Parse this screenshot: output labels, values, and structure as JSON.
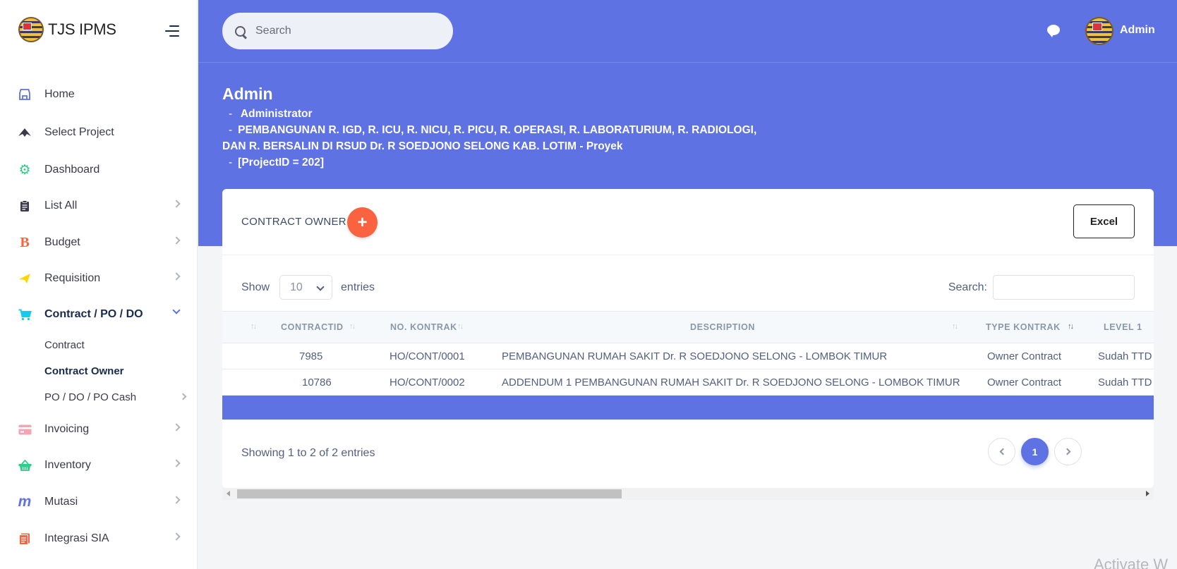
{
  "app": {
    "brand": "TJS IPMS"
  },
  "header": {
    "search_placeholder": "Search",
    "user_name": "Admin"
  },
  "sidebar": {
    "items": [
      {
        "label": "Home",
        "icon": "store-icon",
        "color": "#5e72e4"
      },
      {
        "label": "Select Project",
        "icon": "paper-plane-icon",
        "color": "#3a3a4a"
      },
      {
        "label": "Dashboard",
        "icon": "gear-icon",
        "color": "#2dce89"
      },
      {
        "label": "List All",
        "icon": "clipboard-icon",
        "color": "#3a3a4a"
      },
      {
        "label": "Budget",
        "icon": "bold-b-icon",
        "color": "#fb6340"
      },
      {
        "label": "Requisition",
        "icon": "send-icon",
        "color": "#ffd600"
      },
      {
        "label": "Contract / PO / DO",
        "icon": "cart-icon",
        "color": "#11cdef"
      },
      {
        "label": "Invoicing",
        "icon": "card-icon",
        "color": "#f3a4b5"
      },
      {
        "label": "Inventory",
        "icon": "basket-icon",
        "color": "#2dce89"
      },
      {
        "label": "Mutasi",
        "icon": "m-icon",
        "color": "#5e72e4"
      },
      {
        "label": "Integrasi SIA",
        "icon": "document-icon",
        "color": "#fb6340"
      }
    ],
    "sub_items": [
      {
        "label": "Contract"
      },
      {
        "label": "Contract Owner"
      },
      {
        "label": "PO / DO / PO Cash"
      }
    ]
  },
  "page": {
    "title": "Admin",
    "role": "Administrator",
    "project_line1": "PEMBANGUNAN R. IGD, R. ICU, R. NICU, R. PICU, R. OPERASI, R. LABORATURIUM, R. RADIOLOGI,",
    "project_line2": "DAN R. BERSALIN DI RSUD Dr. R SOEDJONO SELONG KAB. LOTIM - Proyek",
    "project_id": "[ProjectID = 202]",
    "dash": "-"
  },
  "card": {
    "title": "CONTRACT OWNER",
    "add_symbol": "+",
    "excel_label": "Excel",
    "show_label": "Show",
    "entries_label": "entries",
    "page_length": "10",
    "search_label": "Search:",
    "columns": [
      "CONTRACTID",
      "NO. KONTRAK",
      "DESCRIPTION",
      "TYPE KONTRAK",
      "LEVEL 1"
    ],
    "rows": [
      {
        "id": "7985",
        "no": "HO/CONT/0001",
        "desc": "PEMBANGUNAN RUMAH SAKIT Dr. R SOEDJONO SELONG - LOMBOK TIMUR",
        "type": "Owner Contract",
        "level1": "Sudah TTD"
      },
      {
        "id": "10786",
        "no": "HO/CONT/0002",
        "desc": "ADDENDUM 1 PEMBANGUNAN RUMAH SAKIT Dr. R SOEDJONO SELONG - LOMBOK TIMUR",
        "type": "Owner Contract",
        "level1": "Sudah TTD"
      }
    ],
    "info": "Showing 1 to 2 of 2 entries",
    "current_page": "1"
  },
  "watermark": "Activate W",
  "colors": {
    "primary": "#5e72e4",
    "orange": "#fb6340"
  }
}
